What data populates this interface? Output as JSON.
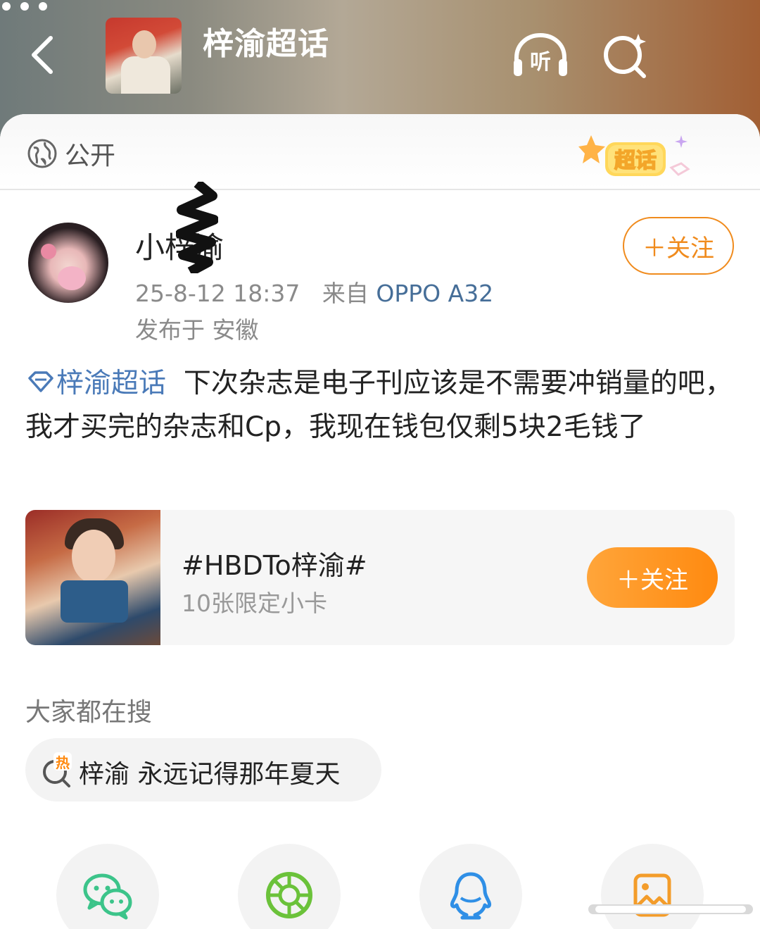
{
  "header": {
    "title": "梓渝超话",
    "listen_label": "听"
  },
  "privacy": {
    "label": "公开",
    "badge_label": "超话"
  },
  "post": {
    "author_name": "小梓渝",
    "timestamp": "25-8-12 18:37",
    "source_prefix": "来自",
    "source_device": "OPPO A32",
    "location": "发布于 安徽",
    "follow_label": "＋关注",
    "topic_link": "梓渝超话",
    "body": "下次杂志是电子刊应该是不需要冲销量的吧，我才买完的杂志和Cp，我现在钱包仅剩5块2毛钱了"
  },
  "topic_card": {
    "title": "#HBDTo梓渝#",
    "subtitle": "10张限定小卡",
    "follow_label": "＋关注"
  },
  "search": {
    "label": "大家都在搜",
    "hot_badge": "热",
    "query": "梓渝 永远记得那年夏天"
  },
  "colors": {
    "accent_orange": "#f08b1d",
    "link_blue": "#4a7ab8",
    "device_blue": "#466e98",
    "wechat_green": "#3cc48a",
    "moments_green": "#6bc23a",
    "qq_blue": "#2f8fe6",
    "save_orange": "#f39c2a"
  },
  "share": {
    "icons": [
      "wechat-icon",
      "moments-icon",
      "qq-icon",
      "save-image-icon"
    ]
  }
}
